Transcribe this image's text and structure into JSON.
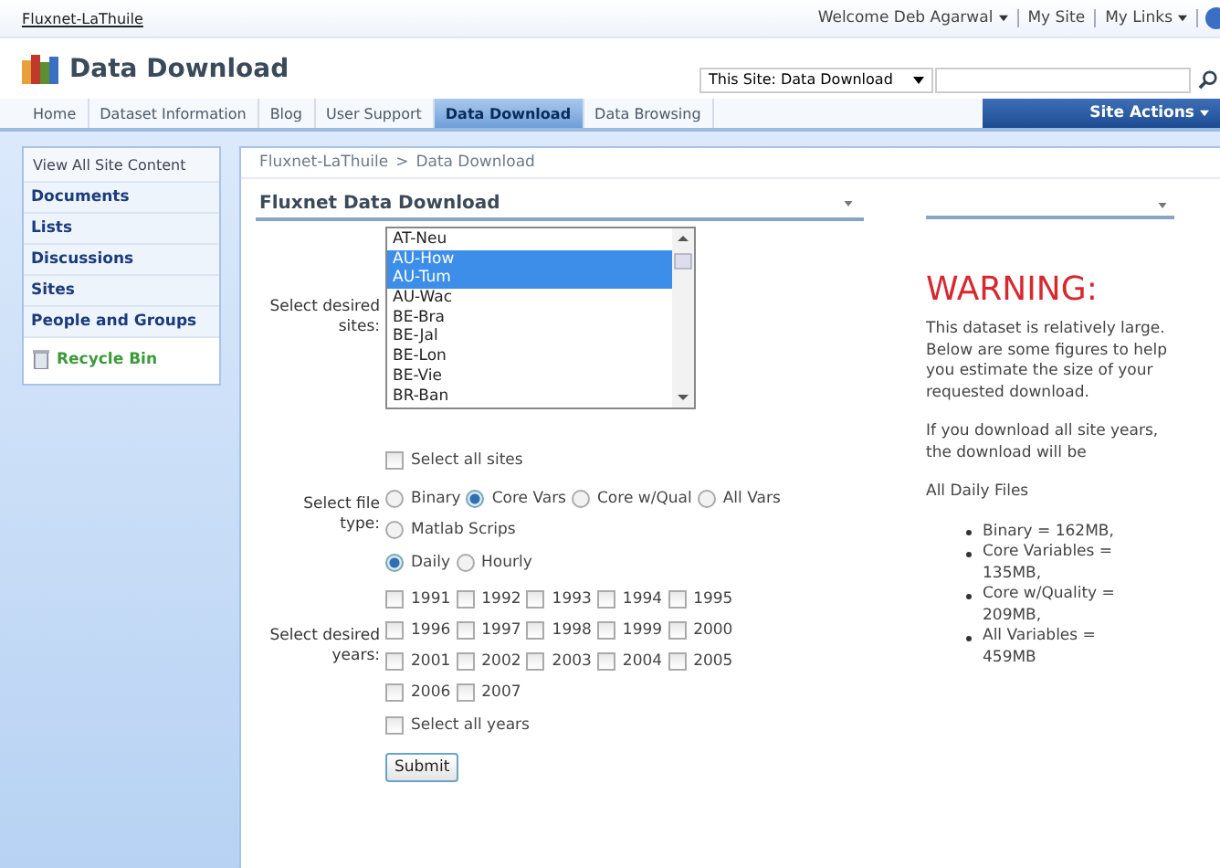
{
  "top_bar": {
    "site_link": "Fluxnet-LaThuile",
    "welcome": "Welcome Deb Agarwal",
    "my_site": "My Site",
    "my_links": "My Links"
  },
  "header": {
    "title": "Data Download",
    "scope": "This Site: Data Download"
  },
  "nav": {
    "tabs": [
      {
        "label": "Home",
        "selected": false
      },
      {
        "label": "Dataset Information",
        "selected": false
      },
      {
        "label": "Blog",
        "selected": false
      },
      {
        "label": "User Support",
        "selected": false
      },
      {
        "label": "Data Download",
        "selected": true
      },
      {
        "label": "Data Browsing",
        "selected": false
      }
    ],
    "site_actions": "Site Actions"
  },
  "quick_launch": {
    "view_all": "View All Site Content",
    "items": [
      {
        "label": "Documents"
      },
      {
        "label": "Lists"
      },
      {
        "label": "Discussions"
      },
      {
        "label": "Sites"
      },
      {
        "label": "People and Groups"
      }
    ],
    "recycle_bin": "Recycle Bin"
  },
  "breadcrumb": {
    "items": [
      "Fluxnet-LaThuile",
      "Data Download"
    ],
    "separator": ">"
  },
  "download_form": {
    "title": "Fluxnet Data Download",
    "sites_label": "Select desired sites:",
    "sites": [
      {
        "label": "AT-Neu",
        "selected": false
      },
      {
        "label": "AU-How",
        "selected": true
      },
      {
        "label": "AU-Tum",
        "selected": true
      },
      {
        "label": "AU-Wac",
        "selected": false
      },
      {
        "label": "BE-Bra",
        "selected": false
      },
      {
        "label": "BE-Jal",
        "selected": false
      },
      {
        "label": "BE-Lon",
        "selected": false
      },
      {
        "label": "BE-Vie",
        "selected": false
      },
      {
        "label": "BR-Ban",
        "selected": false
      }
    ],
    "select_all_sites": {
      "label": "Select all sites",
      "checked": false
    },
    "file_type_label": "Select file type:",
    "file_types": [
      {
        "label": "Binary",
        "selected": false
      },
      {
        "label": "Core Vars",
        "selected": true
      },
      {
        "label": "Core w/Qual",
        "selected": false
      },
      {
        "label": "All Vars",
        "selected": false
      },
      {
        "label": "Matlab Scrips",
        "selected": false
      }
    ],
    "periods": [
      {
        "label": "Daily",
        "selected": true
      },
      {
        "label": "Hourly",
        "selected": false
      }
    ],
    "years_label": "Select desired years:",
    "years": [
      {
        "label": "1991",
        "checked": false
      },
      {
        "label": "1992",
        "checked": false
      },
      {
        "label": "1993",
        "checked": false
      },
      {
        "label": "1994",
        "checked": false
      },
      {
        "label": "1995",
        "checked": false
      },
      {
        "label": "1996",
        "checked": false
      },
      {
        "label": "1997",
        "checked": false
      },
      {
        "label": "1998",
        "checked": false
      },
      {
        "label": "1999",
        "checked": false
      },
      {
        "label": "2000",
        "checked": false
      },
      {
        "label": "2001",
        "checked": false
      },
      {
        "label": "2002",
        "checked": false
      },
      {
        "label": "2003",
        "checked": false
      },
      {
        "label": "2004",
        "checked": false
      },
      {
        "label": "2005",
        "checked": false
      },
      {
        "label": "2006",
        "checked": false
      },
      {
        "label": "2007",
        "checked": false
      }
    ],
    "select_all_years": {
      "label": "Select all years",
      "checked": false
    },
    "submit": "Submit"
  },
  "warning_panel": {
    "heading": "WARNING:",
    "paragraphs": [
      "This dataset is relatively large. Below are some figures to help you estimate the size of your requested download.",
      "If you download all site years, the download will be"
    ],
    "sizes_heading": "All Daily Files",
    "sizes": [
      "Binary = 162MB,",
      "Core Variables = 135MB,",
      "Core w/Quality = 209MB,",
      "All Variables = 459MB"
    ]
  }
}
